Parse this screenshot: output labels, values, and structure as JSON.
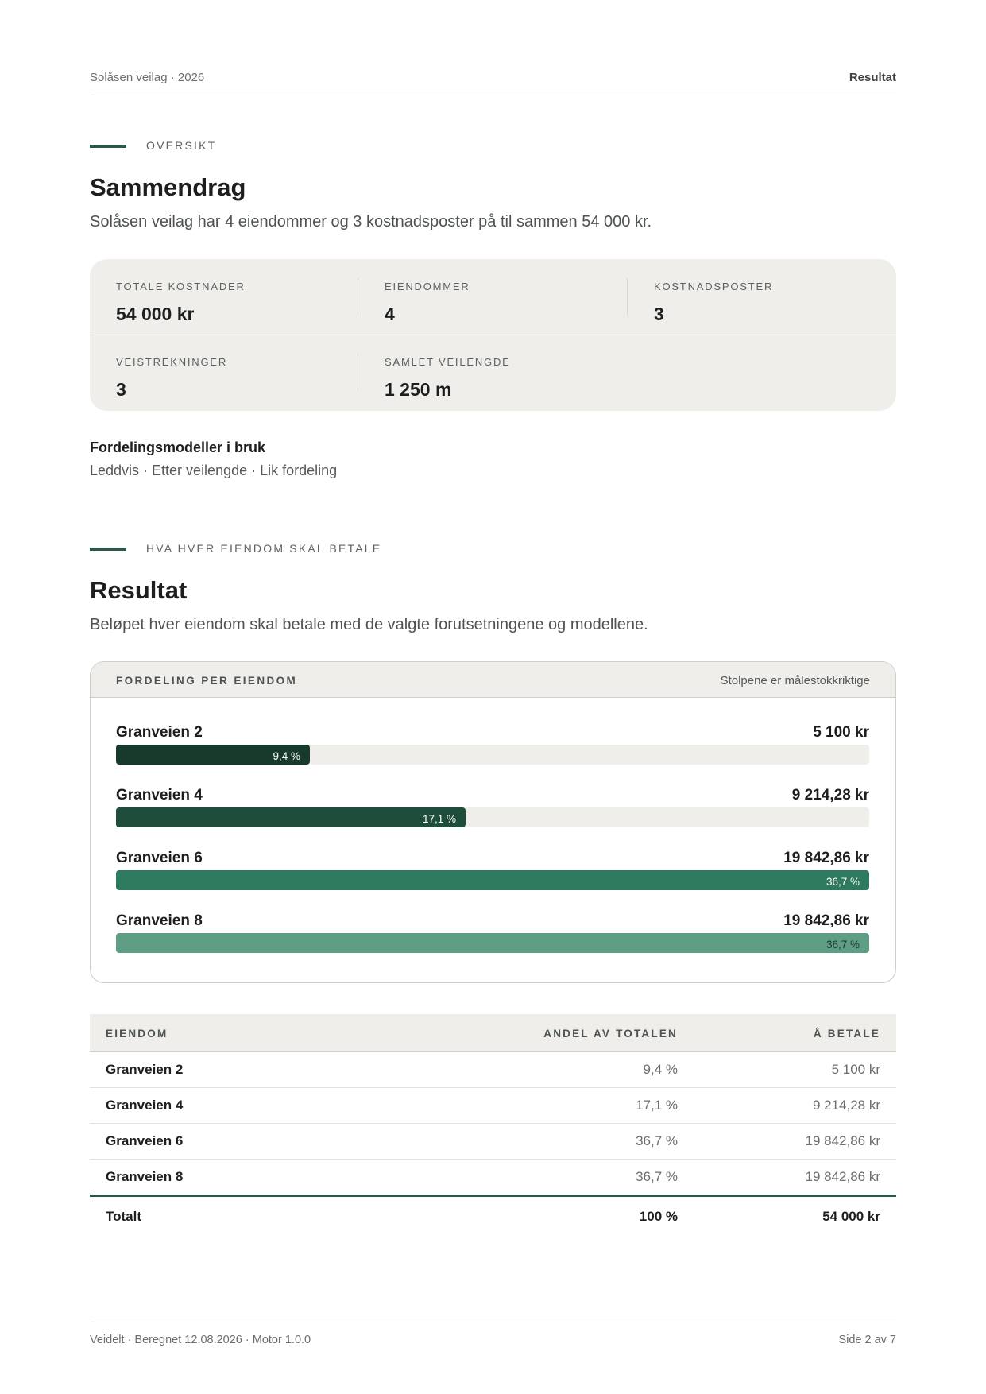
{
  "header": {
    "left": "Solåsen veilag · 2026",
    "right": "Resultat"
  },
  "overview": {
    "eyebrow": "OVERSIKT",
    "title": "Sammendrag",
    "lead": "Solåsen veilag har 4 eiendommer og 3 kostnadsposter på til sammen 54 000 kr.",
    "stats": [
      {
        "label": "TOTALE KOSTNADER",
        "value": "54 000 kr"
      },
      {
        "label": "EIENDOMMER",
        "value": "4"
      },
      {
        "label": "KOSTNADSPOSTER",
        "value": "3"
      },
      {
        "label": "VEISTREKNINGER",
        "value": "3"
      },
      {
        "label": "SAMLET VEILENGDE",
        "value": "1 250 m"
      }
    ],
    "models_title": "Fordelingsmodeller i bruk",
    "models_list": "Leddvis · Etter veilengde · Lik fordeling"
  },
  "result": {
    "eyebrow": "HVA HVER EIENDOM SKAL BETALE",
    "title": "Resultat",
    "lead": "Beløpet hver eiendom skal betale med de valgte forutsetningene og modellene.",
    "chart_title": "FORDELING PER EIENDOM",
    "chart_note": "Stolpene er målestokkriktige"
  },
  "chart_data": {
    "type": "bar",
    "orientation": "horizontal",
    "title": "FORDELING PER EIENDOM",
    "categories": [
      "Granveien 2",
      "Granveien 4",
      "Granveien 6",
      "Granveien 8"
    ],
    "values": [
      5100,
      9214.28,
      19842.86,
      19842.86
    ],
    "amount_labels": [
      "5 100 kr",
      "9 214,28 kr",
      "19 842,86 kr",
      "19 842,86 kr"
    ],
    "percent_labels": [
      "9,4 %",
      "17,1 %",
      "36,7 %",
      "36,7 %"
    ],
    "max": 19842.86,
    "colors": [
      "#173a2c",
      "#1e4d3b",
      "#2d7a5e",
      "#5f9e85"
    ]
  },
  "table": {
    "headers": {
      "name": "EIENDOM",
      "share": "ANDEL AV TOTALEN",
      "pay": "Å BETALE"
    },
    "rows": [
      {
        "name": "Granveien 2",
        "share": "9,4 %",
        "pay": "5 100 kr"
      },
      {
        "name": "Granveien 4",
        "share": "17,1 %",
        "pay": "9 214,28 kr"
      },
      {
        "name": "Granveien 6",
        "share": "36,7 %",
        "pay": "19 842,86 kr"
      },
      {
        "name": "Granveien 8",
        "share": "36,7 %",
        "pay": "19 842,86 kr"
      }
    ],
    "total": {
      "name": "Totalt",
      "share": "100 %",
      "pay": "54 000 kr"
    }
  },
  "footer": {
    "left": "Veidelt · Beregnet 12.08.2026 · Motor 1.0.0",
    "right": "Side 2 av 7"
  }
}
